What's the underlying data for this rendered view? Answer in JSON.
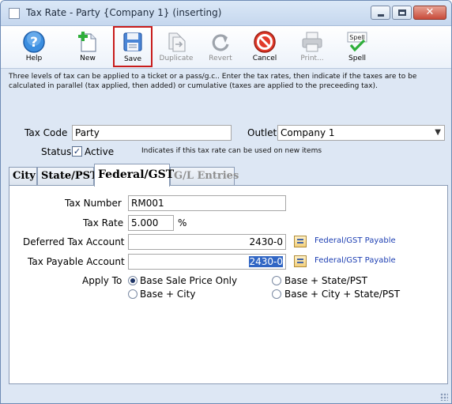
{
  "window": {
    "title": "Tax Rate - Party {Company 1} (inserting)"
  },
  "toolbar": {
    "help": "Help",
    "new": "New",
    "save": "Save",
    "duplicate": "Duplicate",
    "revert": "Revert",
    "cancel": "Cancel",
    "print": "Print...",
    "spell": "Spell"
  },
  "description": "Three levels of tax can be applied to a ticket or a pass/g.c.. Enter the tax rates, then indicate if the taxes are to be calculated in parallel (tax applied, then added) or cumulative (taxes are applied to the preceeding tax).",
  "form": {
    "tax_code_label": "Tax Code",
    "tax_code_value": "Party",
    "outlet_label": "Outlet",
    "outlet_value": "Company 1",
    "status_label": "Status",
    "active_label": "Active",
    "active_checked": true,
    "active_note": "Indicates if this tax rate can be used on new items"
  },
  "tabs": [
    {
      "label": "City",
      "state": "normal"
    },
    {
      "label": "State/PST",
      "state": "normal"
    },
    {
      "label": "Federal/GST",
      "state": "active"
    },
    {
      "label": "G/L Entries",
      "state": "disabled"
    }
  ],
  "federal": {
    "tax_number_label": "Tax Number",
    "tax_number_value": "RM001",
    "tax_rate_label": "Tax Rate",
    "tax_rate_value": "5.000",
    "tax_rate_unit": "%",
    "deferred_label": "Deferred Tax Account",
    "deferred_value": "2430-0",
    "deferred_link": "Federal/GST Payable",
    "payable_label": "Tax Payable Account",
    "payable_value": "2430-0",
    "payable_link": "Federal/GST Payable",
    "apply_to_label": "Apply To",
    "apply_options": [
      {
        "label": "Base Sale Price Only",
        "selected": true
      },
      {
        "label": "Base + State/PST",
        "selected": false
      },
      {
        "label": "Base + City",
        "selected": false
      },
      {
        "label": "Base + City + State/PST",
        "selected": false
      }
    ]
  },
  "icons": {
    "help": "help-icon",
    "new": "new-document-icon",
    "save": "save-disk-icon",
    "duplicate": "duplicate-icon",
    "revert": "revert-icon",
    "cancel": "cancel-icon",
    "print": "printer-icon",
    "spell": "spell-check-icon"
  },
  "colors": {
    "link": "#1d3fb3",
    "highlight_border": "#c81c1c",
    "selection": "#3166c4"
  }
}
